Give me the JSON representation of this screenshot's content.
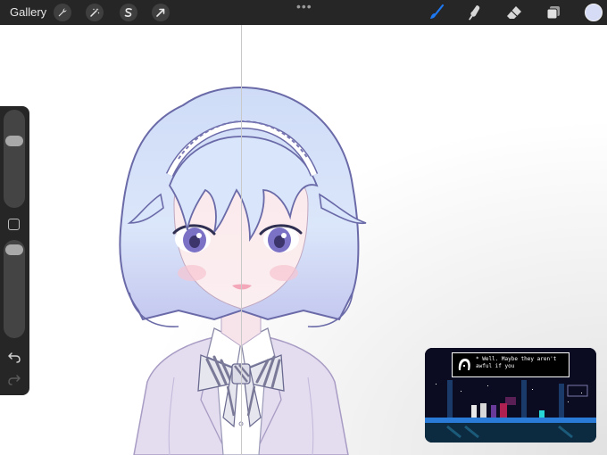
{
  "toolbar": {
    "gallery_label": "Gallery",
    "left_tools": [
      "wrench-icon",
      "magic-wand-icon",
      "selection-icon",
      "transform-arrow-icon"
    ],
    "more_dots": "•••",
    "right_tools": [
      "brush-icon",
      "smudge-icon",
      "eraser-icon",
      "layers-icon"
    ],
    "active_tool": "brush",
    "active_tool_color": "#1e78f0",
    "current_color": "#d6dcf6"
  },
  "sidebar": {
    "brush_size_level": 0.7,
    "opacity_level": 0.95,
    "icons": [
      "modify-square-icon",
      "undo-icon",
      "redo-icon"
    ]
  },
  "pip": {
    "dialog_text": "* Well. Maybe they aren't\n  awful if you"
  },
  "colors": {
    "toolbar_bg": "#262626",
    "hair": "#c8d6f5",
    "hair_line": "#6a6aa8",
    "blazer": "#ddd5ec"
  }
}
